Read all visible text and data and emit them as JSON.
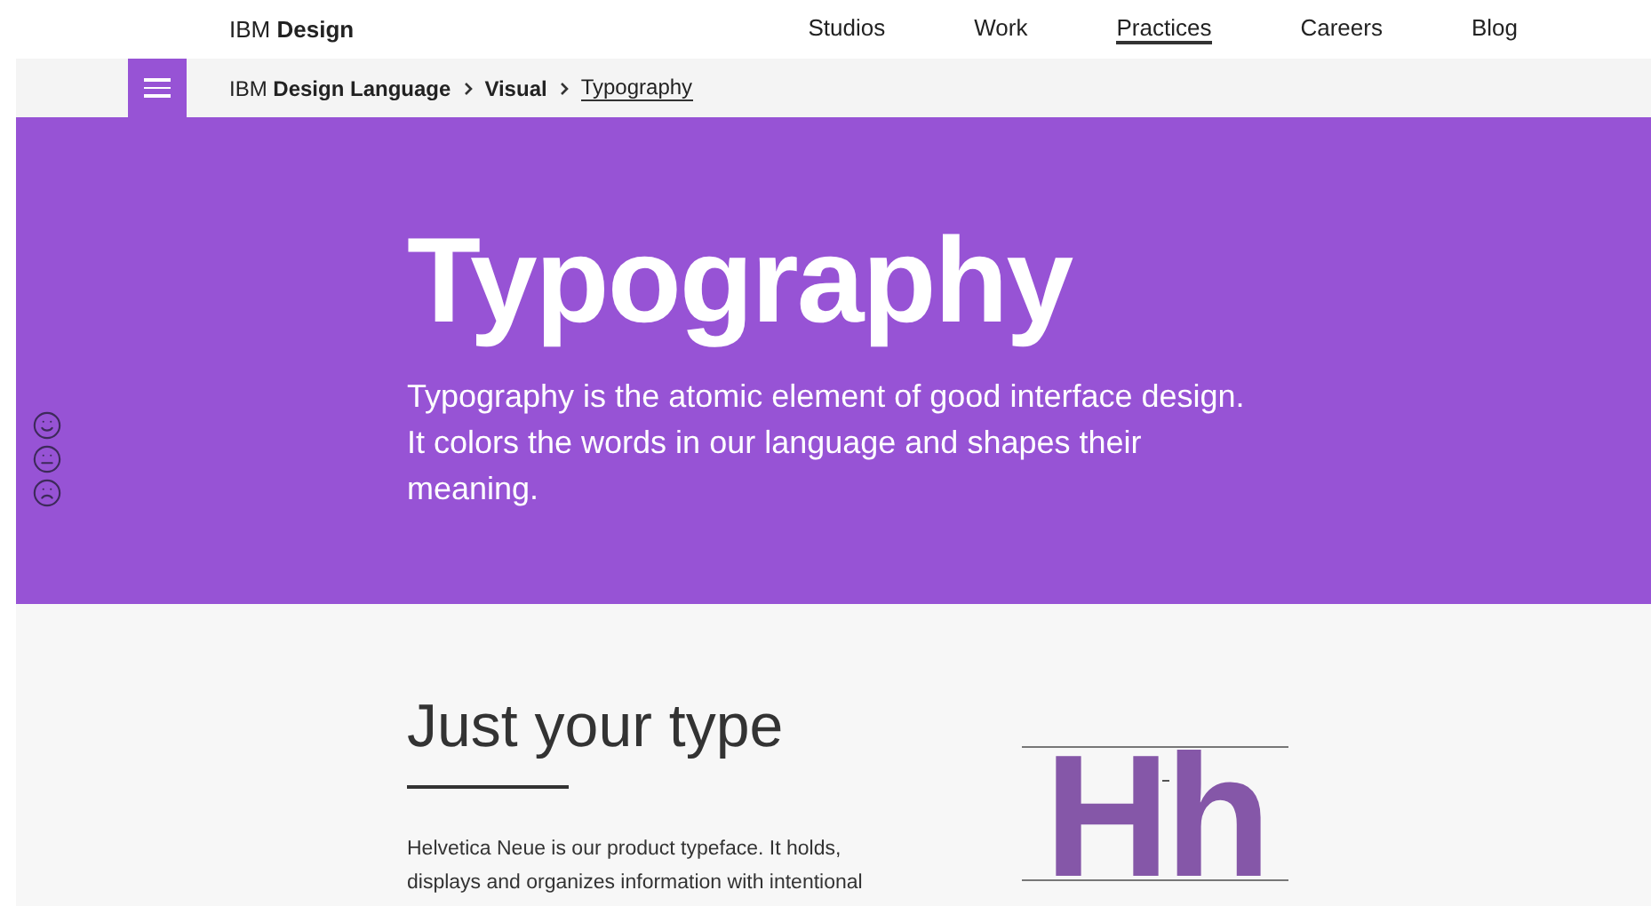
{
  "header": {
    "logo": "IBM **Design**",
    "nav": [
      {
        "label": "Studios",
        "selected": false
      },
      {
        "label": "Work",
        "selected": false
      },
      {
        "label": "Practices",
        "selected": true
      },
      {
        "label": "Careers",
        "selected": false
      },
      {
        "label": "Blog",
        "selected": false
      }
    ]
  },
  "breadcrumb": [
    {
      "label": "IBM **Design Language**",
      "selected": false
    },
    {
      "label": "**Visual**",
      "selected": false
    },
    {
      "label": "Typography",
      "selected": true
    }
  ],
  "hero": {
    "title": "Typography",
    "text": "Typography is the atomic element of good interface design. It colors the words in our language and shapes their meaning."
  },
  "section": {
    "title": "Just your type",
    "text": "Helvetica Neue is our product typeface. It holds, displays and organizes information with intentional",
    "specimen": "Hh"
  }
}
